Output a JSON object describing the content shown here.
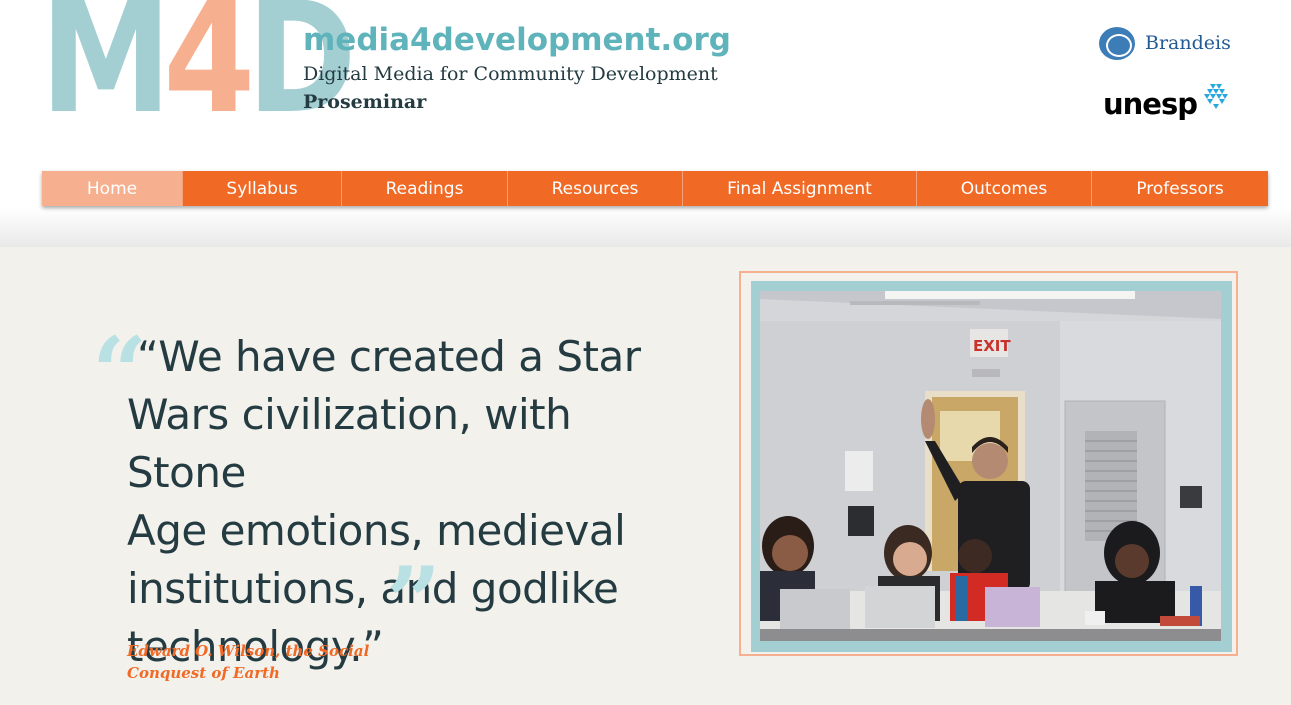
{
  "header": {
    "logo": {
      "m": "M",
      "four": "4",
      "d": "D"
    },
    "site_title": "media4development.org",
    "subtitle": "Digital Media for Community Development",
    "subtitle2": "Proseminar",
    "partners": {
      "brandeis": "Brandeis",
      "unesp": "unesp"
    }
  },
  "nav": {
    "items": [
      {
        "label": "Home",
        "active": true
      },
      {
        "label": "Syllabus"
      },
      {
        "label": "Readings"
      },
      {
        "label": "Resources"
      },
      {
        "label": "Final Assignment"
      },
      {
        "label": "Outcomes"
      },
      {
        "label": "Professors"
      }
    ]
  },
  "quote": {
    "open_mark": "“",
    "close_mark": "”",
    "line1": "“We have created a Star",
    "line2": "Wars civilization, with Stone",
    "line3": "Age emotions, medieval",
    "line4": "institutions, and godlike",
    "line5": "technology.”",
    "attribution": "Edward O. Wilson, the Social Conquest of Earth"
  },
  "photo": {
    "exit_sign": "EXIT"
  },
  "colors": {
    "accent_orange": "#f06a26",
    "accent_peach": "#f7b08f",
    "accent_teal": "#a3cfd3",
    "title_teal": "#5fb3ba",
    "text_dark": "#243b42"
  },
  "icons": {
    "brandeis_logo": "brandeis-seal-icon",
    "unesp_logo": "unesp-mark-icon"
  }
}
